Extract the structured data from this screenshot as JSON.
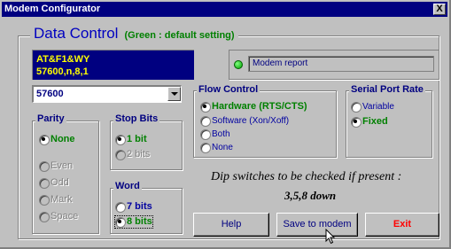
{
  "window": {
    "title": "Modem Configurator",
    "close_label": "X"
  },
  "heading": {
    "title": "Data Control",
    "subtitle": "(Green : default setting)"
  },
  "init": {
    "line1": "AT&F1&WY",
    "line2": "57600,n,8,1"
  },
  "report": {
    "label": "Modem report",
    "led_color": "#00c000"
  },
  "baud": {
    "selected": "57600"
  },
  "parity": {
    "label": "Parity",
    "options": [
      {
        "label": "None",
        "checked": true
      },
      {
        "label": "Even",
        "checked": false
      },
      {
        "label": "Odd",
        "checked": false
      },
      {
        "label": "Mark",
        "checked": false
      },
      {
        "label": "Space",
        "checked": false
      }
    ]
  },
  "stop_bits": {
    "label": "Stop Bits",
    "options": [
      {
        "label": "1 bit",
        "checked": true
      },
      {
        "label": "2 bits",
        "checked": false
      }
    ]
  },
  "word": {
    "label": "Word",
    "options": [
      {
        "label": "7 bits",
        "checked": false
      },
      {
        "label": "8 bits",
        "checked": true
      }
    ]
  },
  "flow_control": {
    "label": "Flow Control",
    "options": [
      {
        "label": "Hardware (RTS/CTS)",
        "checked": true
      },
      {
        "label": "Software (Xon/Xoff)",
        "checked": false
      },
      {
        "label": "Both",
        "checked": false
      },
      {
        "label": "None",
        "checked": false
      }
    ]
  },
  "serial_port_rate": {
    "label": "Serial Port Rate",
    "options": [
      {
        "label": "Variable",
        "checked": false
      },
      {
        "label": "Fixed",
        "checked": true
      }
    ]
  },
  "dip": {
    "line1": "Dip switches to be checked if present :",
    "line2": "3,5,8 down"
  },
  "buttons": {
    "help": "Help",
    "save": "Save to modem",
    "exit": "Exit"
  },
  "colors": {
    "title_bar": "#000080",
    "accent_blue": "#0000c0",
    "default_green": "#008000",
    "exit_red": "#ff0000",
    "init_text": "#ffff00"
  }
}
